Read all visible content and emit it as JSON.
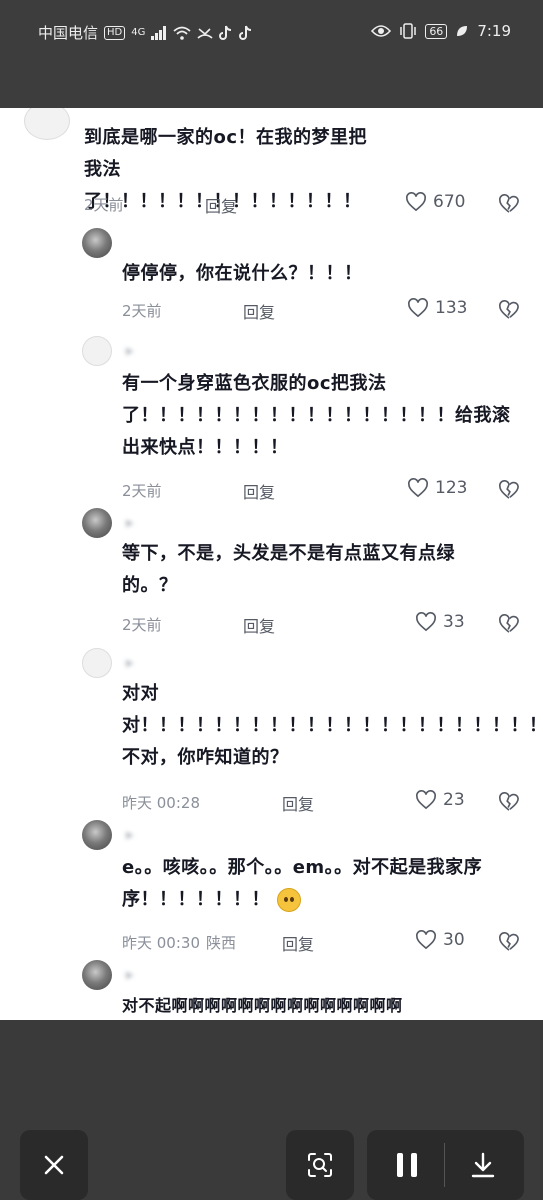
{
  "status_bar": {
    "carrier": "中国电信",
    "hd": "HD",
    "network": "4G",
    "battery": "66",
    "time": "7:19"
  },
  "comments": [
    {
      "username": "",
      "text": "到底是哪一家的oc！在我的梦里把我法了！！！！！！！！！！！！！！",
      "time": "2天前",
      "location": "",
      "reply": "回复",
      "likes": "670"
    },
    {
      "username": "",
      "text": "停停停，你在说什么？！！！",
      "time": "2天前",
      "location": "",
      "reply": "回复",
      "likes": "133"
    },
    {
      "username": "",
      "reply_to": "",
      "text": "有一个身穿蓝色衣服的oc把我法了！！！！！！！！！！！！！！！！！给我滚出来快点！！！！！",
      "time": "2天前",
      "location": "",
      "reply": "回复",
      "likes": "123"
    },
    {
      "username": "",
      "reply_to": "",
      "text": "等下，不是，头发是不是有点蓝又有点绿的。？",
      "time": "2天前",
      "location": "",
      "reply": "回复",
      "likes": "33"
    },
    {
      "username": "",
      "reply_to": "",
      "text": "对对对！！！！！！！！！！！！！！！！！！！！！！！！！不对，你咋知道的？",
      "time": "昨天 00:28",
      "location": "",
      "reply": "回复",
      "likes": "23"
    },
    {
      "username": "",
      "reply_to": "",
      "text": "e。。咳咳。。那个。。em。。对不起是我家序序！！！！！！！",
      "time": "昨天 00:30",
      "location": "陕西",
      "reply": "回复",
      "likes": "30"
    },
    {
      "username": "",
      "reply_to": "",
      "text": "对不起啊啊啊啊啊啊啊啊啊啊啊啊啊啊"
    }
  ],
  "icons": {
    "close": "close-icon",
    "scan": "scan-search-icon",
    "pause": "pause-icon",
    "download": "download-icon",
    "heart": "heart-icon",
    "dislike": "broken-heart-icon"
  },
  "colors": {
    "panel_bg": "#ffffff",
    "overlay_bg": "#3a3a3a",
    "text": "#161823",
    "meta": "#8a8f99"
  }
}
